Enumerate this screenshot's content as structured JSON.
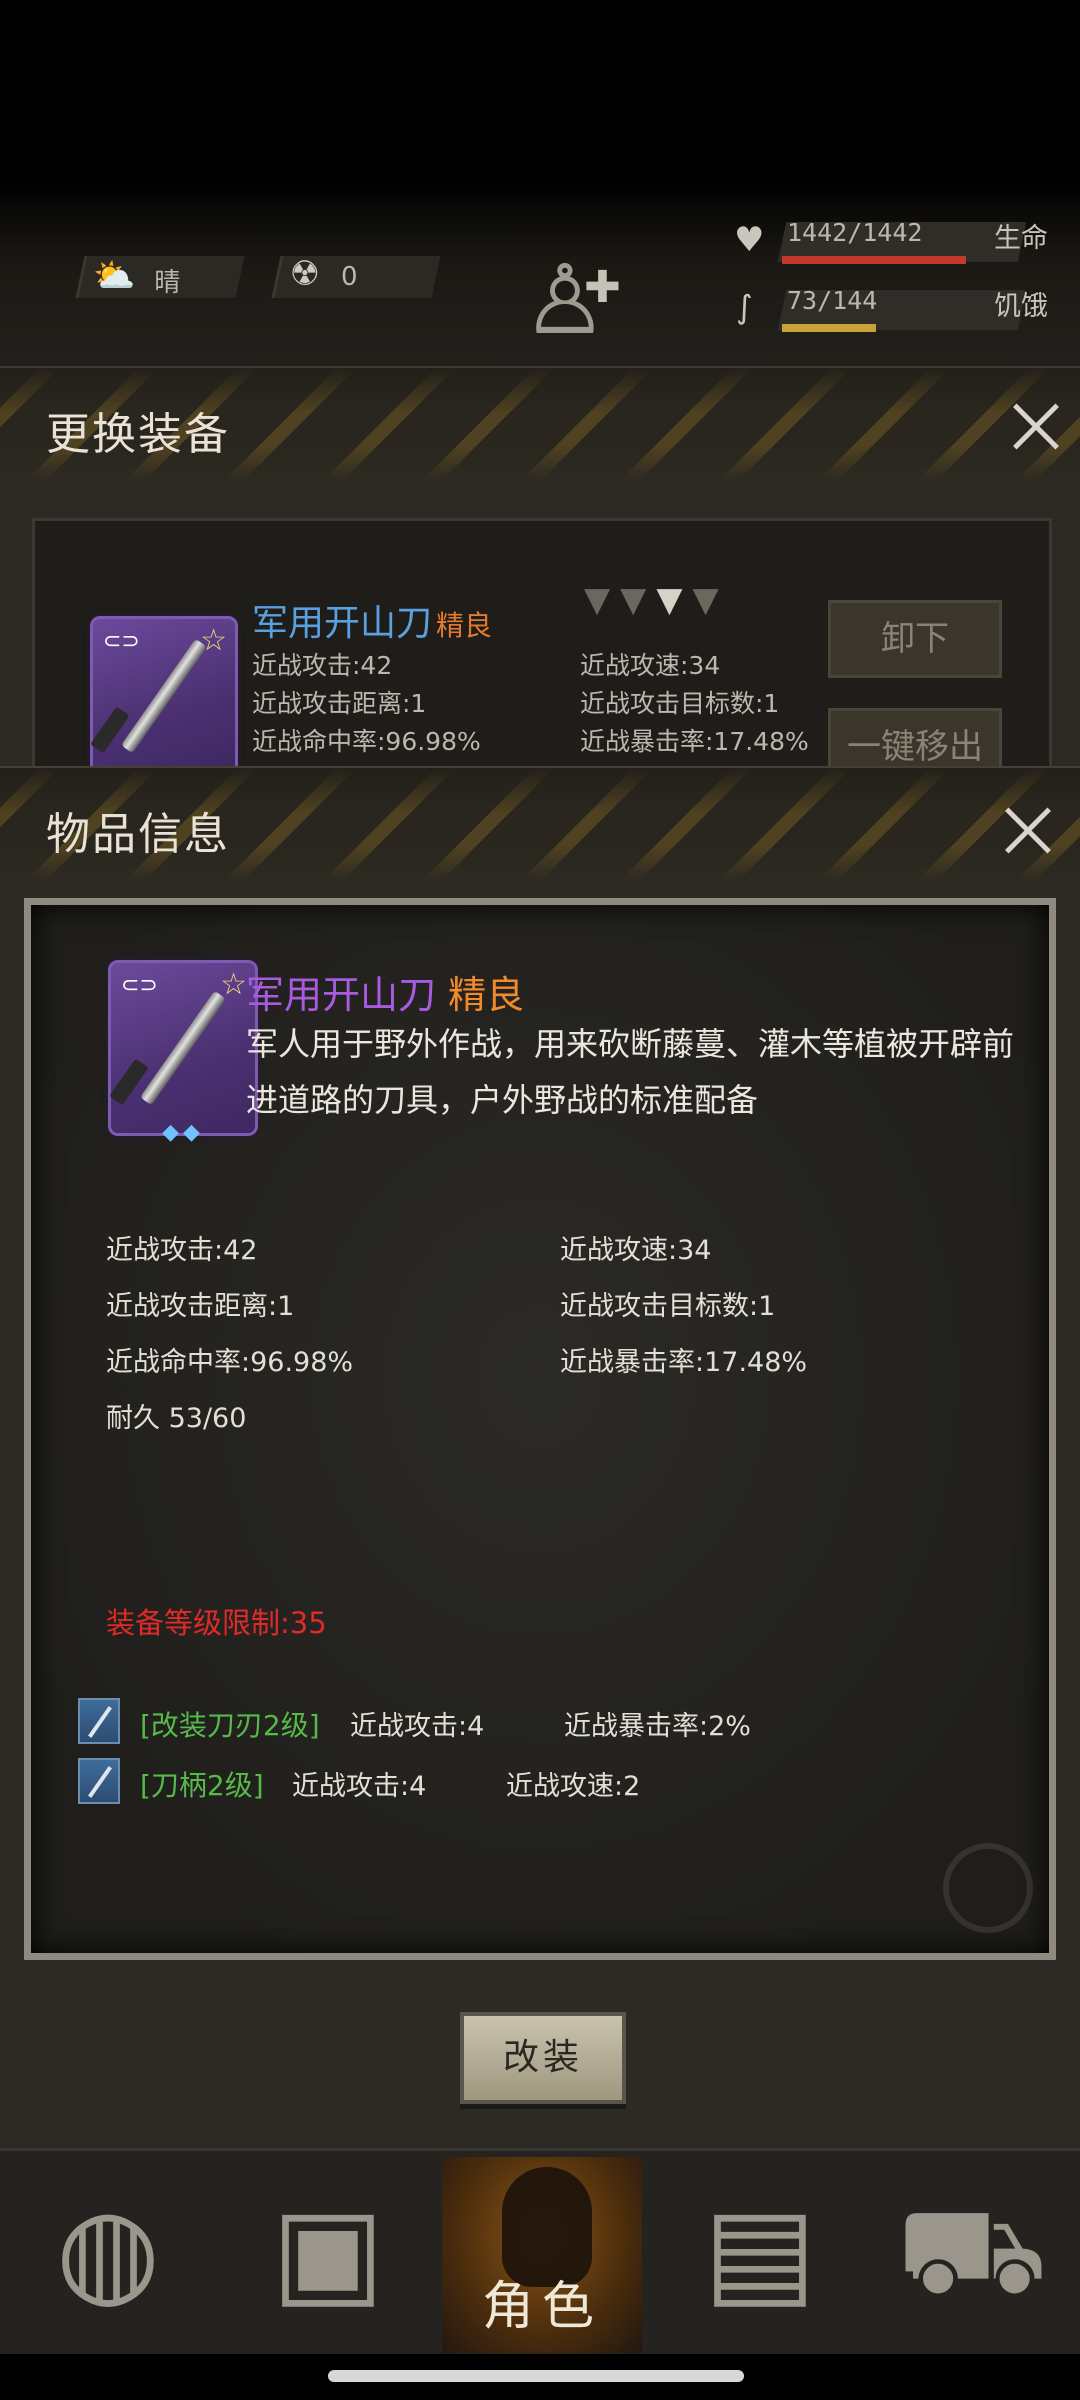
{
  "hud": {
    "weather": "晴",
    "radiation": "0",
    "health": {
      "value": "1442/1442",
      "label": "生命",
      "fraction": 1.0,
      "color": "#c23a2c"
    },
    "hunger": {
      "value": "73/144",
      "label": "饥饿",
      "fraction": 0.51,
      "color": "#c9a23a"
    }
  },
  "equip_panel": {
    "title": "更换装备",
    "item": {
      "name": "军用开山刀",
      "quality": "精良",
      "stats": [
        "近战攻击:42",
        "近战攻速:34",
        "近战攻击距离:1",
        "近战攻击目标数:1",
        "近战命中率:96.98%",
        "近战暴击率:17.48%"
      ]
    },
    "unequip_label": "卸下",
    "move_out_label": "一键移出"
  },
  "info_panel": {
    "title": "物品信息",
    "item": {
      "name": "军用开山刀",
      "quality": "精良",
      "description": "军人用于野外作战，用来砍断藤蔓、灌木等植被开辟前进道路的刀具，户外野战的标准配备"
    },
    "stats": [
      "近战攻击:42",
      "近战攻速:34",
      "近战攻击距离:1",
      "近战攻击目标数:1",
      "近战命中率:96.98%",
      "近战暴击率:17.48%",
      "耐久 53/60"
    ],
    "requirement": "装备等级限制:35",
    "mods": [
      {
        "name": "[改装刀刃2级]",
        "stat1": "近战攻击:4",
        "stat2": "近战暴击率:2%"
      },
      {
        "name": "[刀柄2级]",
        "stat1": "近战攻击:4",
        "stat2": "近战攻速:2"
      }
    ],
    "modify_label": "改装"
  },
  "nav": {
    "items": [
      {
        "icon": "globe-icon"
      },
      {
        "icon": "backpack-icon"
      },
      {
        "icon": "character-icon",
        "label": "角色"
      },
      {
        "icon": "radio-icon"
      },
      {
        "icon": "cart-icon"
      }
    ]
  }
}
